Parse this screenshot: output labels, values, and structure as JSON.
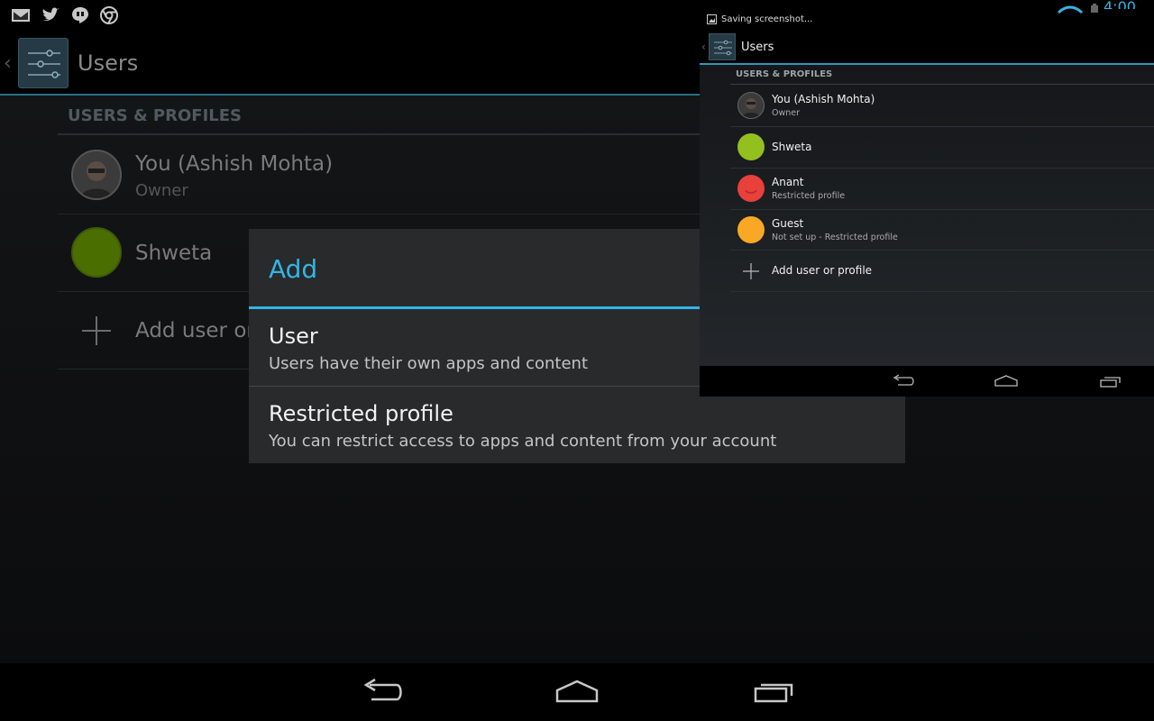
{
  "main": {
    "status_icons": [
      "gmail-icon",
      "twitter-icon",
      "hangouts-icon",
      "chrome-icon"
    ],
    "action_bar": {
      "title": "Users"
    },
    "section_header": "USERS & PROFILES",
    "users": [
      {
        "name": "You (Ashish Mohta)",
        "subtitle": "Owner",
        "avatar": "photo-avatar"
      },
      {
        "name": "Shweta",
        "avatar_color": "#4a6e00"
      }
    ],
    "add_label": "Add user or profile"
  },
  "dialog": {
    "title": "Add",
    "items": [
      {
        "title": "User",
        "subtitle": "Users have their own apps and content"
      },
      {
        "title": "Restricted profile",
        "subtitle": "You can restrict access to apps and content from your account"
      }
    ]
  },
  "inset": {
    "status_text": "Saving screenshot...",
    "clock": "4:00",
    "action_bar_title": "Users",
    "section_header": "USERS & PROFILES",
    "users": [
      {
        "name": "You (Ashish Mohta)",
        "subtitle": "Owner",
        "avatar": "photo-avatar"
      },
      {
        "name": "Shweta",
        "subtitle": "",
        "avatar_color": "#93c01f"
      },
      {
        "name": "Anant",
        "subtitle": "Restricted profile",
        "avatar_color": "#e8403a"
      },
      {
        "name": "Guest",
        "subtitle": "Not set up - Restricted profile",
        "avatar_color": "#f9a825"
      }
    ],
    "add_label": "Add user or profile"
  },
  "colors": {
    "accent": "#33b5e5",
    "dialog_bg": "#282a2b"
  }
}
